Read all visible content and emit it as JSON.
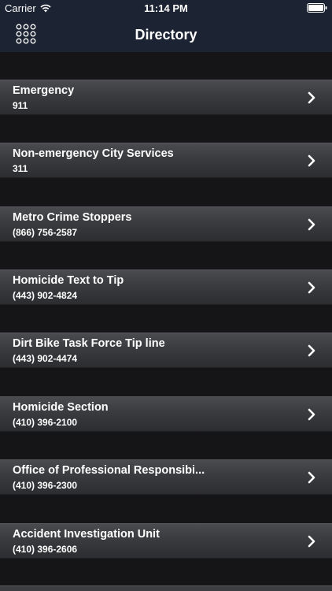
{
  "status_bar": {
    "carrier": "Carrier",
    "time": "11:14 PM"
  },
  "nav": {
    "title": "Directory",
    "menu_icon": "grid-menu-icon"
  },
  "items": [
    {
      "title": "Emergency",
      "phone": "911"
    },
    {
      "title": "Non-emergency City Services",
      "phone": "311"
    },
    {
      "title": "Metro Crime Stoppers",
      "phone": "(866) 756-2587"
    },
    {
      "title": "Homicide Text to Tip",
      "phone": "(443) 902-4824"
    },
    {
      "title": "Dirt Bike Task Force Tip line",
      "phone": "(443) 902-4474"
    },
    {
      "title": "Homicide Section",
      "phone": "(410) 396-2100"
    },
    {
      "title": "Office of Professional Responsibi...",
      "phone": "(410) 396-2300"
    },
    {
      "title": "Accident Investigation Unit",
      "phone": "(410) 396-2606"
    }
  ],
  "colors": {
    "nav_background": "#1c2333",
    "page_background": "#151517",
    "row_gradient_top": "#4a4b4f",
    "row_gradient_bottom": "#2c2d30"
  }
}
